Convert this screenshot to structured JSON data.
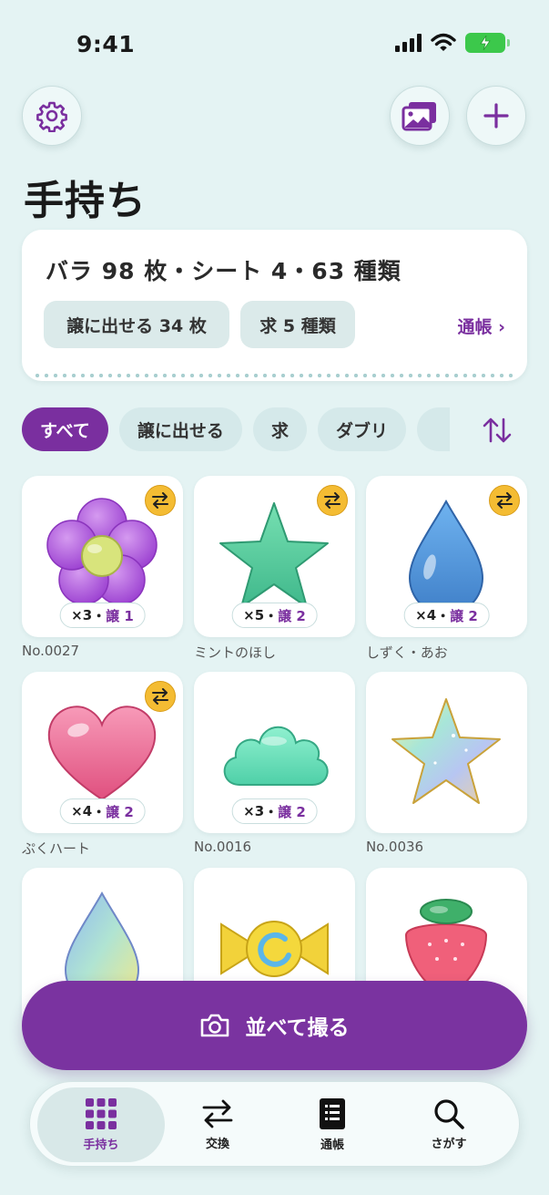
{
  "status_bar": {
    "time": "9:41"
  },
  "page_title": "手持ち",
  "summary": {
    "text": "バラ 98 枚・シート 4・63 種類",
    "chip_tradeable": "譲に出せる 34 枚",
    "chip_wanted": "求 5 種類",
    "passbook_link": "通帳 ›"
  },
  "filters": [
    "すべて",
    "譲に出せる",
    "求",
    "ダブリ"
  ],
  "stickers": [
    {
      "caption": "No.0027",
      "qty": "×3",
      "trade": "譲 1",
      "tradeable": true,
      "shape": "flower-icon"
    },
    {
      "caption": "ミントのほし",
      "qty": "×5",
      "trade": "譲 2",
      "tradeable": true,
      "shape": "star-icon"
    },
    {
      "caption": "しずく・あお",
      "qty": "×4",
      "trade": "譲 2",
      "tradeable": true,
      "shape": "drop-icon"
    },
    {
      "caption": "ぷくハート",
      "qty": "×4",
      "trade": "譲 2",
      "tradeable": true,
      "shape": "heart-icon"
    },
    {
      "caption": "No.0016",
      "qty": "×3",
      "trade": "譲 2",
      "tradeable": false,
      "shape": "cloud-icon"
    },
    {
      "caption": "No.0036",
      "qty": "",
      "trade": "",
      "tradeable": false,
      "shape": "holo-star-icon"
    },
    {
      "caption": "",
      "qty": "",
      "trade": "",
      "tradeable": false,
      "shape": "holo-drop-icon"
    },
    {
      "caption": "",
      "qty": "",
      "trade": "",
      "tradeable": false,
      "shape": "candy-icon"
    },
    {
      "caption": "",
      "qty": "",
      "trade": "",
      "tradeable": false,
      "shape": "strawberry-icon"
    }
  ],
  "qty_separator": "・",
  "shoot_button": "並べて撮る",
  "tabs": [
    {
      "label": "手持ち",
      "icon": "grid-icon"
    },
    {
      "label": "交換",
      "icon": "swap-icon"
    },
    {
      "label": "通帳",
      "icon": "book-icon"
    },
    {
      "label": "さがす",
      "icon": "search-icon"
    }
  ],
  "colors": {
    "accent": "#7a2f9f",
    "background": "#e4f3f3",
    "badge": "#f4bc33"
  }
}
